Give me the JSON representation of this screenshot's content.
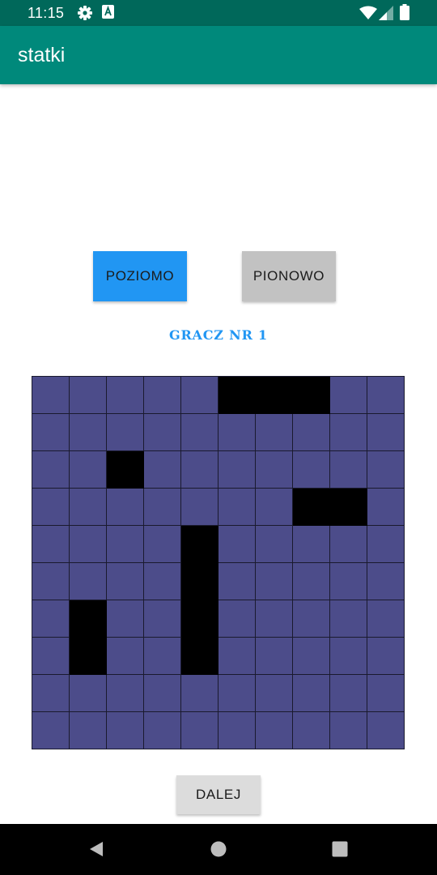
{
  "status_bar": {
    "time": "11:15",
    "icons": [
      "gear-icon",
      "a-badge-icon",
      "wifi-icon",
      "signal-icon",
      "battery-icon"
    ]
  },
  "app_bar": {
    "title": "statki"
  },
  "orientation": {
    "horizontal_label": "POZIOMO",
    "vertical_label": "PIONOWO",
    "selected": "POZIOMO"
  },
  "player_label": "GRACZ NR 1",
  "board": {
    "size": 10,
    "rows": [
      "0000011100",
      "0000000000",
      "0010000000",
      "0000000110",
      "0000100000",
      "0000100000",
      "0100100000",
      "0100100000",
      "0000000000",
      "0000000000"
    ],
    "colors": {
      "water": "#4c4c8a",
      "ship": "#000000",
      "grid": "#1a1a2e"
    }
  },
  "next_button": {
    "label": "DALEJ"
  },
  "nav_bar": {
    "icons": [
      "back-icon",
      "home-icon",
      "recents-icon"
    ]
  },
  "colors": {
    "app_bar": "#00897b",
    "status_bar": "#00685a",
    "accent": "#2196f3"
  }
}
